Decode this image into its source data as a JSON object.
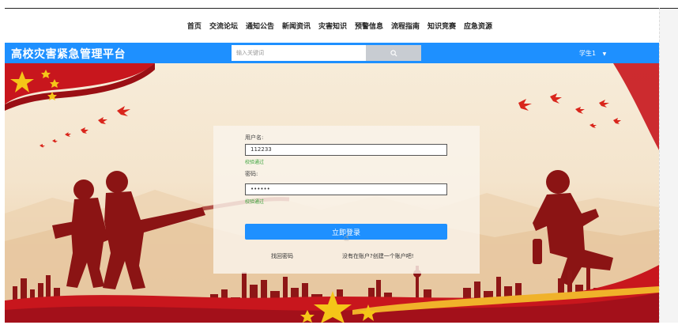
{
  "nav": {
    "items": [
      "首页",
      "交流论坛",
      "通知公告",
      "新闻资讯",
      "灾害知识",
      "预警信息",
      "流程指南",
      "知识竞赛",
      "应急资源"
    ]
  },
  "header": {
    "brand": "高校灾害紧急管理平台",
    "search_placeholder": "输入关键词",
    "user_label": "学生1",
    "user_caret": "▼"
  },
  "login": {
    "username_label": "用户名:",
    "username_value": "112233",
    "username_status": "校验通过",
    "password_label": "密码:",
    "password_value": "••••••",
    "password_status": "校验通过",
    "submit_label": "立即登录",
    "forgot_label": "找回密码",
    "register_label": "没有在账户?创建一个账户吧!"
  },
  "colors": {
    "primary": "#1e90ff",
    "success": "#3aa33a",
    "silhouette": "#8b1414",
    "flag_red": "#c8161d",
    "star_gold": "#f5c518"
  }
}
